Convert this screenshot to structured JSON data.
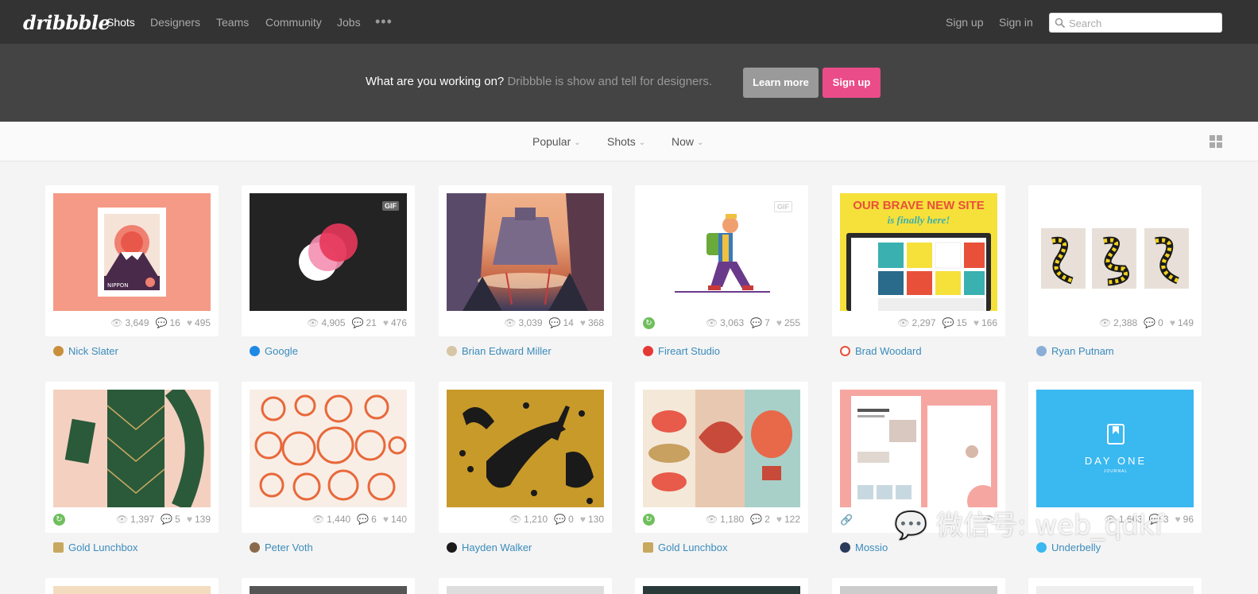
{
  "nav": {
    "logo": "dribbble",
    "links": [
      "Shots",
      "Designers",
      "Teams",
      "Community",
      "Jobs"
    ],
    "more": "•••",
    "sign_up": "Sign up",
    "sign_in": "Sign in",
    "search_placeholder": "Search"
  },
  "banner": {
    "question": "What are you working on?",
    "tagline": "Dribbble is show and tell for designers.",
    "learn_more": "Learn more",
    "sign_up": "Sign up"
  },
  "filters": [
    "Popular",
    "Shots",
    "Now"
  ],
  "shots": [
    {
      "views": "3,649",
      "comments": "16",
      "likes": "495",
      "author": "Nick Slater"
    },
    {
      "views": "4,905",
      "comments": "21",
      "likes": "476",
      "author": "Google",
      "badge": "GIF"
    },
    {
      "views": "3,039",
      "comments": "14",
      "likes": "368",
      "author": "Brian Edward Miller"
    },
    {
      "views": "3,063",
      "comments": "7",
      "likes": "255",
      "author": "Fireart Studio",
      "badge": "GIF"
    },
    {
      "views": "2,297",
      "comments": "15",
      "likes": "166",
      "author": "Brad Woodard",
      "headline": "OUR BRAVE NEW SITE",
      "subline": "is finally here!"
    },
    {
      "views": "2,388",
      "comments": "0",
      "likes": "149",
      "author": "Ryan Putnam"
    },
    {
      "views": "1,397",
      "comments": "5",
      "likes": "139",
      "author": "Gold Lunchbox"
    },
    {
      "views": "1,440",
      "comments": "6",
      "likes": "140",
      "author": "Peter Voth"
    },
    {
      "views": "1,210",
      "comments": "0",
      "likes": "130",
      "author": "Hayden Walker"
    },
    {
      "views": "1,180",
      "comments": "2",
      "likes": "122",
      "author": "Gold Lunchbox"
    },
    {
      "views": "",
      "comments": "",
      "likes": "",
      "author": "Mossio"
    },
    {
      "views": "1,663",
      "comments": "3",
      "likes": "96",
      "author": "Underbelly",
      "logo_text": "DAY ONE",
      "logo_sub": "JOURNAL"
    }
  ],
  "watermark": "微信号: web_qdkf",
  "colors": {
    "accent": "#ea4c89",
    "link": "#3a8bbb",
    "topbar": "#333333",
    "banner": "#444444"
  }
}
